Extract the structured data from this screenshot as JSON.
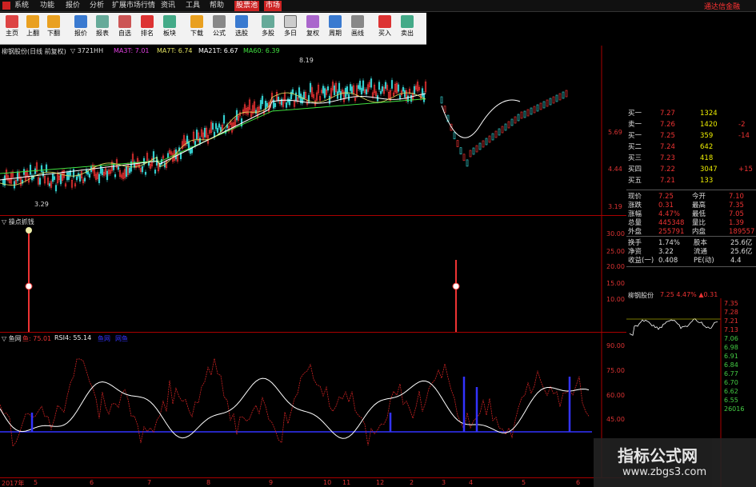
{
  "menu": {
    "items": [
      "系统",
      "功能",
      "报价",
      "分析",
      "扩展市场行情",
      "资讯",
      "工具",
      "帮助"
    ],
    "tag_a": "股票池",
    "tag_b": "市场",
    "right_text": "通达信金融"
  },
  "toolbar": {
    "buttons": [
      "主页",
      "上翻",
      "下翻",
      "报价",
      "报表",
      "自选",
      "排名",
      "板块",
      "下载",
      "公式",
      "选股",
      "多股",
      "多日",
      "复权",
      "周期",
      "画线",
      "买入",
      "卖出"
    ]
  },
  "main_chart": {
    "title": "柳钢股份(日线 前复权)",
    "suffix": "▽ 3721HH",
    "ma": [
      {
        "label": "MA3T: 7.01",
        "color": "#e040e0"
      },
      {
        "label": "MA7T: 6.74",
        "color": "#e0e060"
      },
      {
        "label": "MA21T: 6.67",
        "color": "#ffffff"
      },
      {
        "label": "MA60: 6.39",
        "color": "#40e040"
      }
    ],
    "hi_label": "8.19",
    "lo_label": "3.29",
    "y_ticks": [
      "5.69",
      "4.44",
      "3.19"
    ]
  },
  "pane2": {
    "title": "▽ 操点抓钱",
    "y_ticks": [
      "30.00",
      "25.00",
      "20.00",
      "15.00",
      "10.00"
    ]
  },
  "pane3": {
    "title": "▽ 鱼网",
    "v1": "鱼: 75.01",
    "v2": "RSI4: 55.14",
    "v3": "鱼网",
    "v4": "网鱼",
    "y_ticks": [
      "90.00",
      "75.00",
      "60.00",
      "45.00"
    ]
  },
  "x_axis": {
    "labels": [
      "2017年",
      "5",
      "6",
      "7",
      "8",
      "9",
      "10",
      "11",
      "12",
      "2",
      "3",
      "4",
      "5",
      "6"
    ]
  },
  "quote": {
    "rows_top": [
      {
        "label": "买一",
        "price": "7.27",
        "vol": "1324",
        "chg": ""
      },
      {
        "label": "卖一",
        "price": "7.26",
        "vol": "1420",
        "chg": "-2"
      },
      {
        "label": "买一",
        "price": "7.25",
        "vol": "359",
        "chg": "-14"
      },
      {
        "label": "买二",
        "price": "7.24",
        "vol": "642",
        "chg": ""
      },
      {
        "label": "买三",
        "price": "7.23",
        "vol": "418",
        "chg": ""
      },
      {
        "label": "买四",
        "price": "7.22",
        "vol": "3047",
        "chg": "+15"
      },
      {
        "label": "买五",
        "price": "7.21",
        "vol": "133",
        "chg": ""
      }
    ],
    "stats": [
      {
        "l1": "现价",
        "v1": "7.25",
        "l2": "今开",
        "v2": "7.10"
      },
      {
        "l1": "涨跌",
        "v1": "0.31",
        "l2": "最高",
        "v2": "7.35"
      },
      {
        "l1": "涨幅",
        "v1": "4.47%",
        "l2": "最低",
        "v2": "7.05"
      },
      {
        "l1": "总量",
        "v1": "445348",
        "l2": "量比",
        "v2": "1.39"
      },
      {
        "l1": "外盘",
        "v1": "255791",
        "l2": "内盘",
        "v2": "189557"
      }
    ],
    "fin": [
      {
        "l1": "换手",
        "v1": "1.74%",
        "l2": "股本",
        "v2": "25.6亿"
      },
      {
        "l1": "净资",
        "v1": "3.22",
        "l2": "流通",
        "v2": "25.6亿"
      },
      {
        "l1": "收益(一)",
        "v1": "0.408",
        "l2": "PE(动)",
        "v2": "4.4"
      }
    ],
    "mini_title": "柳钢股份",
    "mini_info": "7.25 4.47% ▲0.31",
    "mini_ticks": [
      "7.35",
      "7.28",
      "7.21",
      "7.13",
      "7.06",
      "6.98",
      "6.91",
      "6.84",
      "6.77",
      "6.70",
      "6.62",
      "6.55",
      "26016"
    ]
  },
  "watermark": {
    "title": "指标公式网",
    "url": "www.zbgs3.com"
  }
}
